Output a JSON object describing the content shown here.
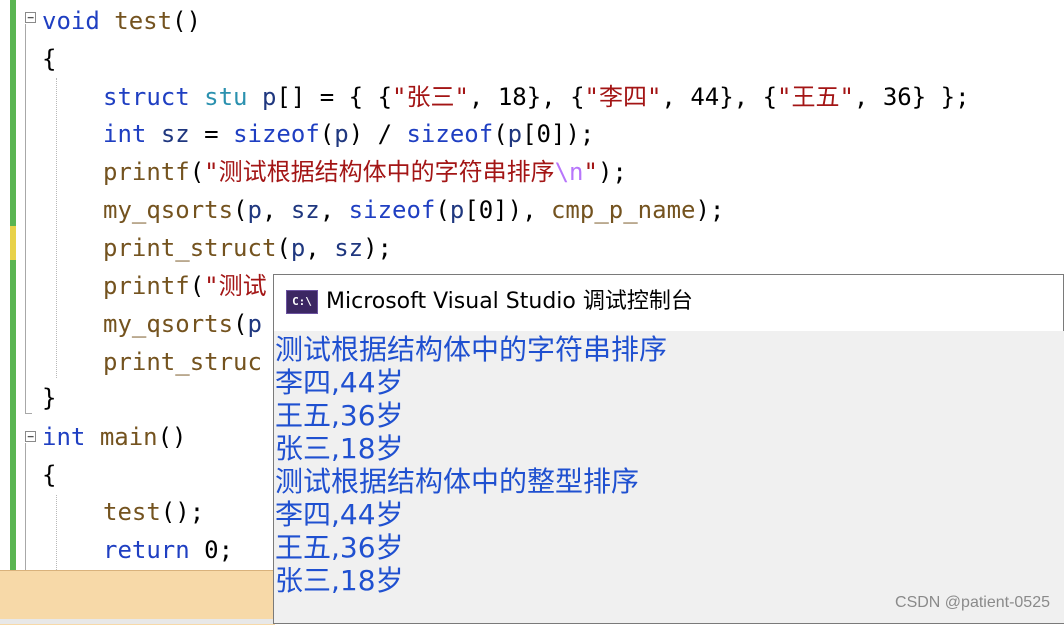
{
  "editor": {
    "lines": {
      "l1": [
        "void",
        " ",
        "test",
        "()"
      ],
      "l2": [
        "{"
      ],
      "l3": [
        "struct",
        " ",
        "stu",
        " ",
        "p",
        "[] = { {",
        "\"张三\"",
        ", 18}, {",
        "\"李四\"",
        ", 44}, {",
        "\"王五\"",
        ", 36} };"
      ],
      "l4": [
        "int",
        " ",
        "sz",
        " = ",
        "sizeof",
        "(",
        "p",
        ") / ",
        "sizeof",
        "(",
        "p",
        "[0]);"
      ],
      "l5": [
        "printf",
        "(",
        "\"测试根据结构体中的字符串排序",
        "\\n",
        "\"",
        ");"
      ],
      "l6": [
        "my_qsorts",
        "(",
        "p",
        ", ",
        "sz",
        ", ",
        "sizeof",
        "(",
        "p",
        "[0]), ",
        "cmp_p_name",
        ");"
      ],
      "l7": [
        "print_struct",
        "(",
        "p",
        ", ",
        "sz",
        ");"
      ],
      "l8": [
        "printf",
        "(",
        "\"测试"
      ],
      "l9": [
        "my_qsorts",
        "(",
        "p"
      ],
      "l10": [
        "print_struc"
      ],
      "l11": [
        "}"
      ],
      "l12": [
        "int",
        " ",
        "main",
        "()"
      ],
      "l13": [
        "{"
      ],
      "l14": [
        "test",
        "();"
      ],
      "l15": [
        "return",
        " 0;"
      ]
    }
  },
  "console": {
    "title": "Microsoft Visual Studio 调试控制台",
    "icon_text": "C:\\",
    "output": [
      "测试根据结构体中的字符串排序",
      "李四,44岁",
      "王五,36岁",
      "张三,18岁",
      "测试根据结构体中的整型排序",
      "李四,44岁",
      "王五,36岁",
      "张三,18岁"
    ]
  },
  "watermark": "CSDN @patient-0525",
  "colors": {
    "keyword": "#1f3fc2",
    "type": "#2b91af",
    "function": "#74531f",
    "string": "#a31515",
    "escape": "#b776fb",
    "variable": "#1f377f",
    "console_text": "#1f50d0"
  }
}
